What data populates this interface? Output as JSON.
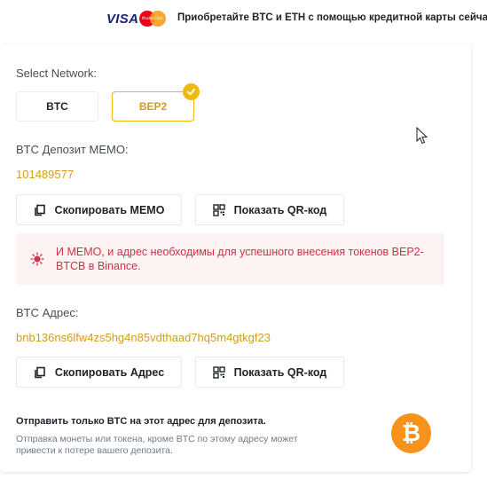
{
  "topbar": {
    "visa_logo": "VISA",
    "mastercard_logo": "MasterCard",
    "promo_text": "Приобретайте BTC и ETH с помощью кредитной карты сейчас »"
  },
  "network": {
    "label": "Select Network:",
    "options": [
      "BTC",
      "BEP2"
    ],
    "selected": "BEP2"
  },
  "memo": {
    "label": "BTC Депозит MEMO:",
    "value": "101489577",
    "copy_label": "Скопировать MEMO",
    "qr_label": "Показать QR-код"
  },
  "alert": {
    "text": "И MEMO, и адрес необходимы для успешного внесения токенов BEP2-BTCB в Binance."
  },
  "address": {
    "label": "BTC Адрес:",
    "value": "bnb136ns6lfw4zs5hg4n85vdthaad7hq5m4gtkgf23",
    "copy_label": "Скопировать Адрес",
    "qr_label": "Показать QR-код"
  },
  "notice": {
    "title": "Отправить только BTC на этот адрес для депозита.",
    "text": "Отправка монеты или токена, кроме BTC по этому адресу может привести к потере вашего депозита."
  },
  "icons": {
    "coin": "bitcoin-coin-icon",
    "copy": "copy-icon",
    "qr": "qr-code-icon",
    "alert": "lightbulb-icon",
    "check": "check-icon"
  },
  "colors": {
    "accent": "#f0b90b",
    "accent_text": "#d29e1a",
    "alert_text": "#cf304a",
    "alert_bg": "#fdf3f3",
    "bitcoin": "#f7931a"
  }
}
